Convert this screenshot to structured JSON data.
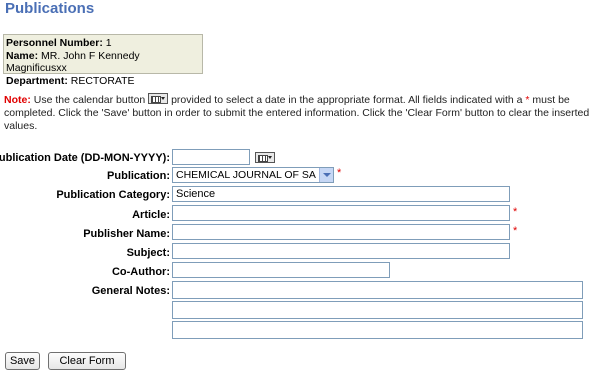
{
  "page": {
    "title": "Publications"
  },
  "personnel": {
    "number_label": "Personnel Number:",
    "number_value": "1",
    "name_label": "Name:",
    "name_value": "MR. John F Kennedy Magnificusxx",
    "dept_label": "Department:",
    "dept_value": "RECTORATE"
  },
  "note": {
    "label": "Note:",
    "text_1": " Use the calendar button ",
    "text_2": " provided to select a date in the appropriate format. All fields indicated with a ",
    "star": "*",
    "text_3": " must be completed. Click the 'Save' button in order to submit the entered information. Click the 'Clear Form' button to clear the inserted values."
  },
  "form": {
    "date_label": "Publication Date (DD-MON-YYYY):",
    "date_value": "",
    "publication_label": "Publication:",
    "publication_value": "CHEMICAL JOURNAL OF SA",
    "category_label": "Publication Category:",
    "category_value": "Science",
    "article_label": "Article:",
    "article_value": "",
    "publisher_label": "Publisher Name:",
    "publisher_value": "",
    "subject_label": "Subject:",
    "subject_value": "",
    "coauthor_label": "Co-Author:",
    "coauthor_value": "",
    "notes_label": "General Notes:",
    "notes_1": "",
    "notes_2": "",
    "notes_3": "",
    "required_mark": "*"
  },
  "buttons": {
    "save": "Save",
    "clear": "Clear Form"
  },
  "icons": {
    "calendar": "calendar-icon",
    "dropdown": "chevron-down-icon"
  }
}
